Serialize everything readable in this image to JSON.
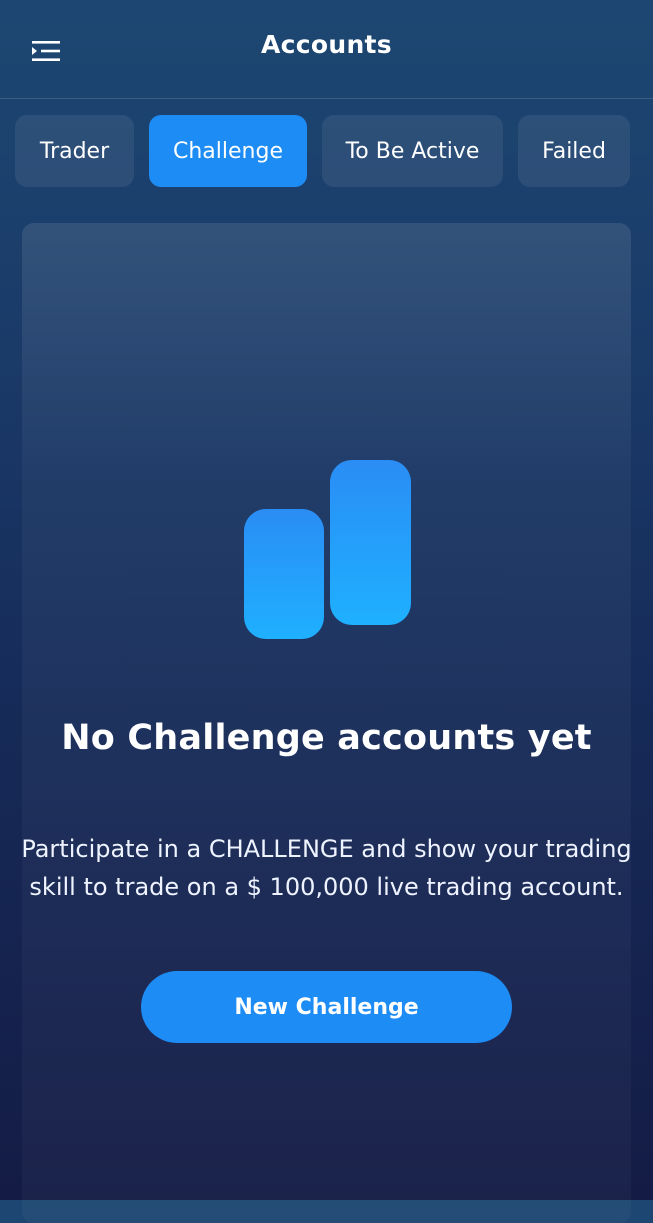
{
  "header": {
    "title": "Accounts",
    "menu_icon": "menu-list-icon"
  },
  "tabs": [
    {
      "label": "Trader",
      "active": false
    },
    {
      "label": "Challenge",
      "active": true
    },
    {
      "label": "To Be Active",
      "active": false
    },
    {
      "label": "Failed",
      "active": false
    }
  ],
  "empty_state": {
    "icon": "bar-chart-icon",
    "title": "No Challenge accounts yet",
    "description": "Participate in a CHALLENGE and show your trading skill to trade on a $ 100,000 live trading account.",
    "button_label": "New Challenge"
  },
  "colors": {
    "accent": "#1e8cf5",
    "background_top": "#1d4772",
    "background_bottom": "#141c45"
  }
}
